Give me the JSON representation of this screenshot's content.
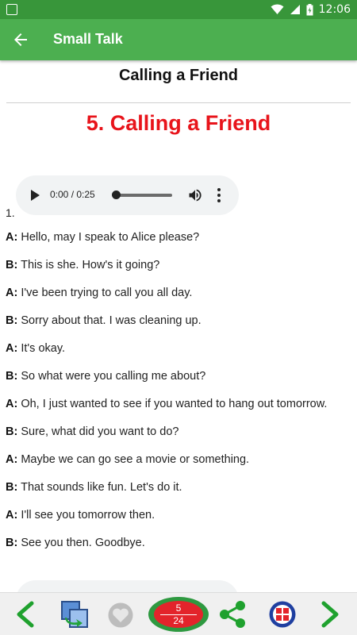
{
  "status_bar": {
    "time": "12:06",
    "icons": [
      "image-icon",
      "wifi-icon",
      "signal-icon",
      "battery-icon"
    ]
  },
  "app_bar": {
    "title": "Small Talk",
    "back_icon": "arrow-back-icon"
  },
  "page": {
    "heading": "Calling a Friend",
    "lesson_title": "5. Calling a Friend",
    "item_number": "1."
  },
  "audio_player": {
    "time": "0:00 / 0:25",
    "progress": 0,
    "icons": [
      "play-icon",
      "volume-icon",
      "more-vert-icon"
    ]
  },
  "dialogue": [
    {
      "speaker": "A:",
      "text": "Hello, may I speak to Alice please?"
    },
    {
      "speaker": "B:",
      "text": "This is she. How's it going?"
    },
    {
      "speaker": "A:",
      "text": "I've been trying to call you all day."
    },
    {
      "speaker": "B:",
      "text": "Sorry about that. I was cleaning up."
    },
    {
      "speaker": "A:",
      "text": "It's okay."
    },
    {
      "speaker": "B:",
      "text": "So what were you calling me about?"
    },
    {
      "speaker": "A:",
      "text": "Oh, I just wanted to see if you wanted to hang out tomorrow."
    },
    {
      "speaker": "B:",
      "text": "Sure, what did you want to do?"
    },
    {
      "speaker": "A:",
      "text": "Maybe we can go see a movie or something."
    },
    {
      "speaker": "B:",
      "text": "That sounds like fun. Let's do it."
    },
    {
      "speaker": "A:",
      "text": "I'll see you tomorrow then."
    },
    {
      "speaker": "B:",
      "text": "See you then. Goodbye."
    }
  ],
  "bottom_bar": {
    "current": "5",
    "total": "24",
    "icons": [
      "chevron-left-icon",
      "switch-icon",
      "heart-icon",
      "share-icon",
      "grid-icon",
      "chevron-right-icon"
    ],
    "colors": {
      "accent_green": "#2e9940",
      "accent_red": "#e3242b",
      "blue": "#1f3fa0"
    }
  },
  "colors": {
    "status_bar": "#38963a",
    "app_bar": "#4caf50",
    "lesson_title": "#e8141b"
  }
}
